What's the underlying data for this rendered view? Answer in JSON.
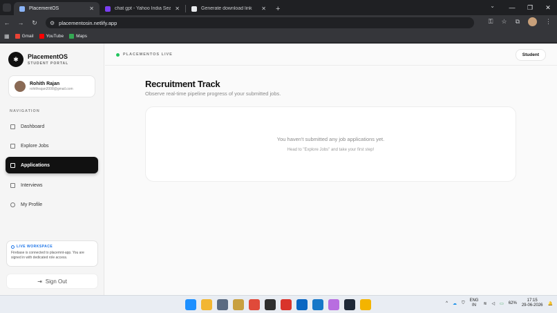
{
  "browser": {
    "tabs": [
      {
        "title": "PlacementOS",
        "active": true,
        "favicon_color": "#8ab4f8"
      },
      {
        "title": "chat gpt - Yahoo India Search R",
        "active": false,
        "favicon_color": "#7b3ff2"
      },
      {
        "title": "Generate download link",
        "active": false,
        "favicon_color": "#e8eaed"
      }
    ],
    "url": "placementosin.netlify.app",
    "bookmarks": [
      {
        "label": "Gmail",
        "color": "#ea4335"
      },
      {
        "label": "YouTube",
        "color": "#ff0000"
      },
      {
        "label": "Maps",
        "color": "#34a853"
      }
    ]
  },
  "brand": {
    "name": "PlacementOS",
    "subtitle": "STUDENT PORTAL"
  },
  "user": {
    "name": "Rohith Rajan",
    "email": "rohithrajan2008@gmail.com"
  },
  "nav": {
    "label": "NAVIGATION",
    "items": [
      {
        "label": "Dashboard",
        "icon": "grid-icon",
        "active": false
      },
      {
        "label": "Explore Jobs",
        "icon": "briefcase-icon",
        "active": false
      },
      {
        "label": "Applications",
        "icon": "document-icon",
        "active": true
      },
      {
        "label": "Interviews",
        "icon": "calendar-icon",
        "active": false
      },
      {
        "label": "My Profile",
        "icon": "user-icon",
        "active": false
      }
    ]
  },
  "workspace": {
    "title": "LIVE WORKSPACE",
    "description": "Firebase is connected to placemnt-app. You are signed in with dedicated role access."
  },
  "signout": {
    "label": "Sign Out"
  },
  "topbar": {
    "status": "PLACEMENTOS LIVE",
    "role": "Student"
  },
  "main": {
    "title": "Recruitment Track",
    "subtitle": "Observe real-time pipeline progress of your submitted jobs.",
    "empty_title": "You haven't submitted any job applications yet.",
    "empty_hint": "Head to \"Explore Jobs\" and take your first step!"
  },
  "taskbar": {
    "lang_top": "ENG",
    "lang_bottom": "IN",
    "battery": "62%",
    "time": "17:15",
    "date": "29-06-2026"
  },
  "colors": {
    "accent": "#111111",
    "live_dot": "#22c55e",
    "info": "#1a73e8"
  }
}
